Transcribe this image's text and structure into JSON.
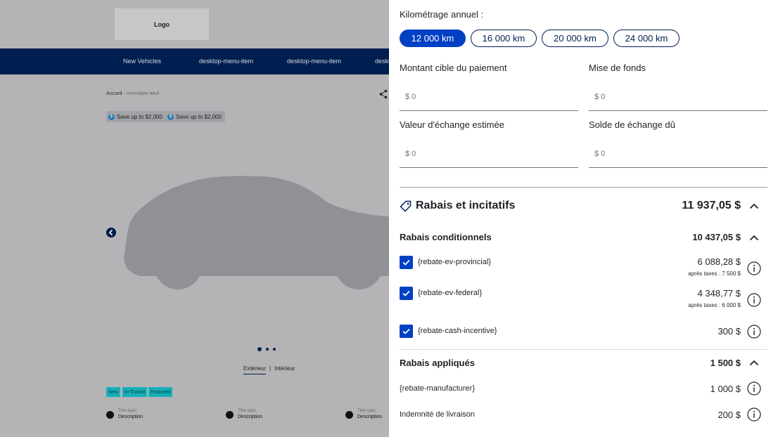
{
  "background": {
    "logo": "Logo",
    "nav": [
      "New Vehicles",
      "desktop-menu-item",
      "desktop-menu-item",
      "desktop-menu-item"
    ],
    "breadcrumb": {
      "home": "Accueil",
      "separator": "›",
      "current": "Inventaire neuf"
    },
    "badges": [
      "Save up to $2,000",
      "Save up to $2,000"
    ],
    "badge_symbol": "$",
    "view_tabs": {
      "exterior": "Extérieur",
      "separator": "|",
      "interior": "Intérieur"
    },
    "tags": [
      "New",
      "In-Transit",
      "Featured"
    ],
    "specs": [
      {
        "title": "Titre spec",
        "desc": "Description"
      },
      {
        "title": "Titre spec",
        "desc": "Description"
      },
      {
        "title": "Titre spec",
        "desc": "Description"
      }
    ]
  },
  "panel": {
    "km_label": "Kilométrage annuel :",
    "km_options": [
      "12 000 km",
      "16 000 km",
      "20 000 km",
      "24 000 km"
    ],
    "km_selected": 0,
    "fields": [
      {
        "label": "Montant cible du paiement",
        "value": "$ 0"
      },
      {
        "label": "Mise de fonds",
        "value": "$ 0"
      },
      {
        "label": "Valeur d'échange estimée",
        "value": "$ 0"
      },
      {
        "label": "Solde de échange dû",
        "value": "$ 0"
      }
    ],
    "rebates": {
      "title": "Rabais et incitatifs",
      "total": "11 937,05 $",
      "conditional": {
        "title": "Rabais conditionnels",
        "total": "10 437,05 $",
        "items": [
          {
            "name": "{rebate-ev-provincial}",
            "amount": "6 088,28 $",
            "after_tax": "après taxes :  7 500 $",
            "checked": true
          },
          {
            "name": "{rebate-ev-federal}",
            "amount": "4 348,77 $",
            "after_tax": "après taxes :  6 000 $",
            "checked": true
          },
          {
            "name": "{rebate-cash-incentive}",
            "amount": "300 $",
            "after_tax": "",
            "checked": true
          }
        ]
      },
      "applied": {
        "title": "Rabais appliqués",
        "total": "1 500 $",
        "items": [
          {
            "name": "{rebate-manufacturer}",
            "amount": "1 000 $"
          },
          {
            "name": "Indemnité de livraison",
            "amount": "200 $"
          }
        ]
      }
    }
  }
}
